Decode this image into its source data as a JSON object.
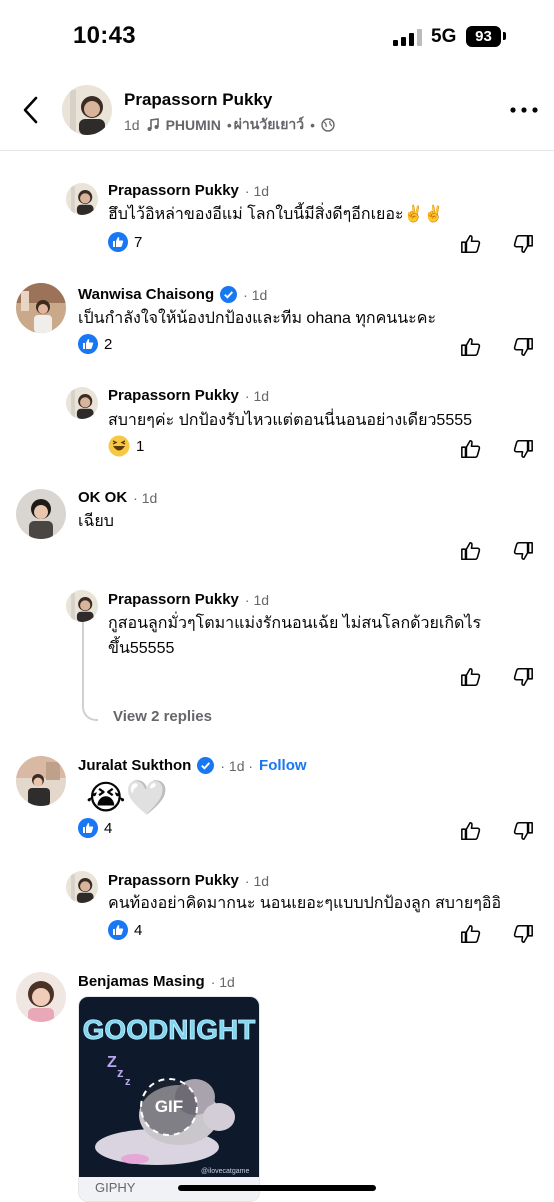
{
  "status_bar": {
    "time": "10:43",
    "network": "5G",
    "battery": "93"
  },
  "header": {
    "name": "Prapassorn Pukky",
    "age": "1d",
    "music": "PHUMIN",
    "music_sep": "•",
    "song": "ผ่านวัยเยาว์",
    "dot": "•"
  },
  "comments": [
    {
      "name": "Prapassorn Pukky",
      "time": "· 1d",
      "text": "ฮึบไว้อิหล่าของอีแม่  โลกใบนี้มีสิ่งดีๆอีกเยอะ✌️✌️",
      "reaction_count": "7"
    },
    {
      "name": "Wanwisa Chaisong",
      "time": "· 1d",
      "text": "เป็นกำลังใจให้น้องปกป้องและทีม ohana ทุกคนนะคะ",
      "reaction_count": "2"
    },
    {
      "name": "Prapassorn Pukky",
      "time": "· 1d",
      "text": "สบายๆค่ะ  ปกป้องรับไหวแต่ตอนนี่นอนอย่างเดียว5555",
      "reaction_count": "1"
    },
    {
      "name": "OK OK",
      "time": "· 1d",
      "text": "เฉียบ"
    },
    {
      "name": "Prapassorn Pukky",
      "time": "· 1d",
      "text_line1": "กูสอนลูกมั่วๆโตมาแม่งรักนอนเฉ้ย ไม่สนโลกด้วยเกิดไร",
      "text_line2": "ขึ้น55555"
    },
    {
      "name": "Juralat Sukthon",
      "time": "· 1d ·",
      "follow": "Follow",
      "reaction_count": "4",
      "emoji": "😭🤍"
    },
    {
      "name": "Prapassorn Pukky",
      "time": "· 1d",
      "text": "คนท้องอย่าคิดมากนะ นอนเยอะๆแบบปกป้องลูก สบายๆอิอิ",
      "reaction_count": "4"
    },
    {
      "name": "Benjamas Masing",
      "time": "· 1d"
    }
  ],
  "view_replies": "View 2 replies",
  "gif": {
    "title": "GOODNIGHT",
    "badge": "GIF",
    "credit": "@ilovecatgame",
    "source": "GIPHY"
  }
}
